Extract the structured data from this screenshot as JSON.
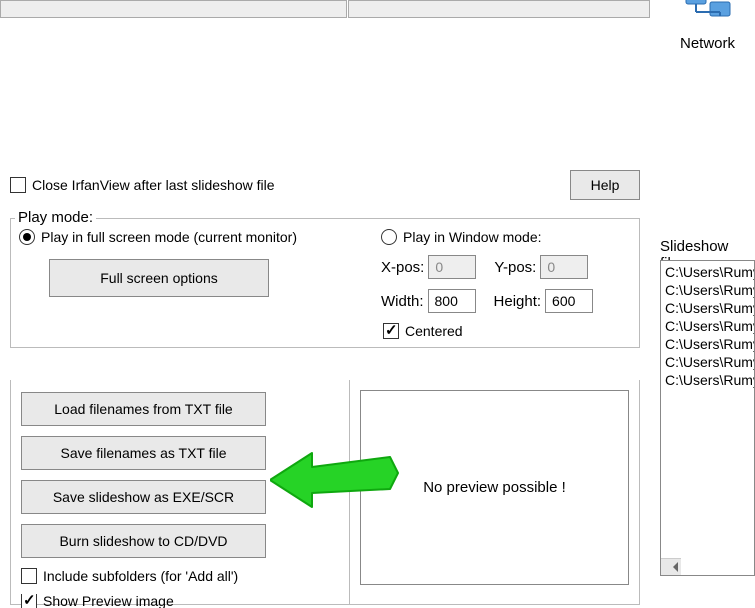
{
  "network": {
    "label": "Network"
  },
  "close_checkbox": {
    "label": "Close IrfanView after last slideshow file",
    "checked": false
  },
  "help_button": "Help",
  "playmode": {
    "legend": "Play mode:",
    "fullscreen_label": "Play in full screen mode (current monitor)",
    "window_label": "Play in Window mode:",
    "selected": "fullscreen",
    "fullscreen_options_btn": "Full screen options",
    "xpos_label": "X-pos:",
    "ypos_label": "Y-pos:",
    "width_label": "Width:",
    "height_label": "Height:",
    "xpos": "0",
    "ypos": "0",
    "width": "800",
    "height": "600",
    "centered_label": "Centered",
    "centered_checked": true
  },
  "buttons": {
    "load_txt": "Load filenames from TXT file",
    "save_txt": "Save filenames as TXT file",
    "save_exe": "Save slideshow as  EXE/SCR",
    "burn": "Burn slideshow to CD/DVD"
  },
  "include_subfolders": {
    "label": "Include subfolders (for 'Add all')",
    "checked": false
  },
  "show_preview": {
    "label": "Show Preview image",
    "checked": true
  },
  "preview_text": "No preview possible !",
  "slideshow_files": {
    "label": "Slideshow files:",
    "items": [
      "C:\\Users\\Rumy",
      "C:\\Users\\Rumy",
      "C:\\Users\\Rumy",
      "C:\\Users\\Rumy",
      "C:\\Users\\Rumy",
      "C:\\Users\\Rumy",
      "C:\\Users\\Rumy"
    ]
  }
}
